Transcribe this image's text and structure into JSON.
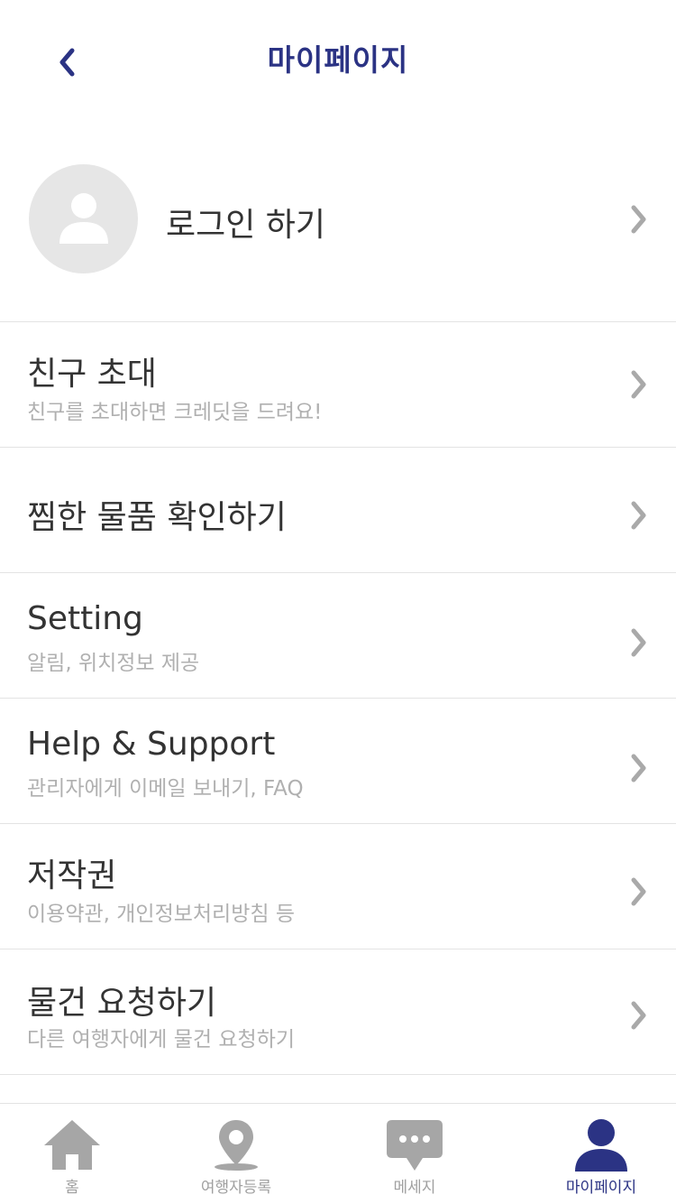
{
  "header": {
    "title": "마이페이지",
    "back_icon": "chevron-left-icon"
  },
  "profile": {
    "login_label": "로그인 하기",
    "avatar_icon": "user-icon"
  },
  "menu": [
    {
      "title": "친구 초대",
      "subtitle": "친구를 초대하면 크레딧을 드려요!"
    },
    {
      "title": "찜한 물품 확인하기",
      "subtitle": ""
    },
    {
      "title": "Setting",
      "subtitle": "알림, 위치정보 제공"
    },
    {
      "title": "Help & Support",
      "subtitle": "관리자에게 이메일 보내기, FAQ"
    },
    {
      "title": "저작권",
      "subtitle": "이용약관, 개인정보처리방침 등"
    },
    {
      "title": "물건 요청하기",
      "subtitle": "다른 여행자에게 물건 요청하기"
    }
  ],
  "tabbar": {
    "items": [
      {
        "label": "홈",
        "icon": "home-icon",
        "active": false
      },
      {
        "label": "여행자등록",
        "icon": "location-pin-icon",
        "active": false
      },
      {
        "label": "메세지",
        "icon": "message-bubble-icon",
        "active": false
      },
      {
        "label": "마이페이지",
        "icon": "user-icon",
        "active": true
      }
    ]
  },
  "colors": {
    "accent": "#2b3384",
    "text": "#333333",
    "subtext": "#b0b0b0",
    "chevron": "#a9a9a9",
    "inactive_icon": "#a6a6a6",
    "avatar_bg": "#e6e6e6",
    "divider": "#e3e3e3"
  }
}
